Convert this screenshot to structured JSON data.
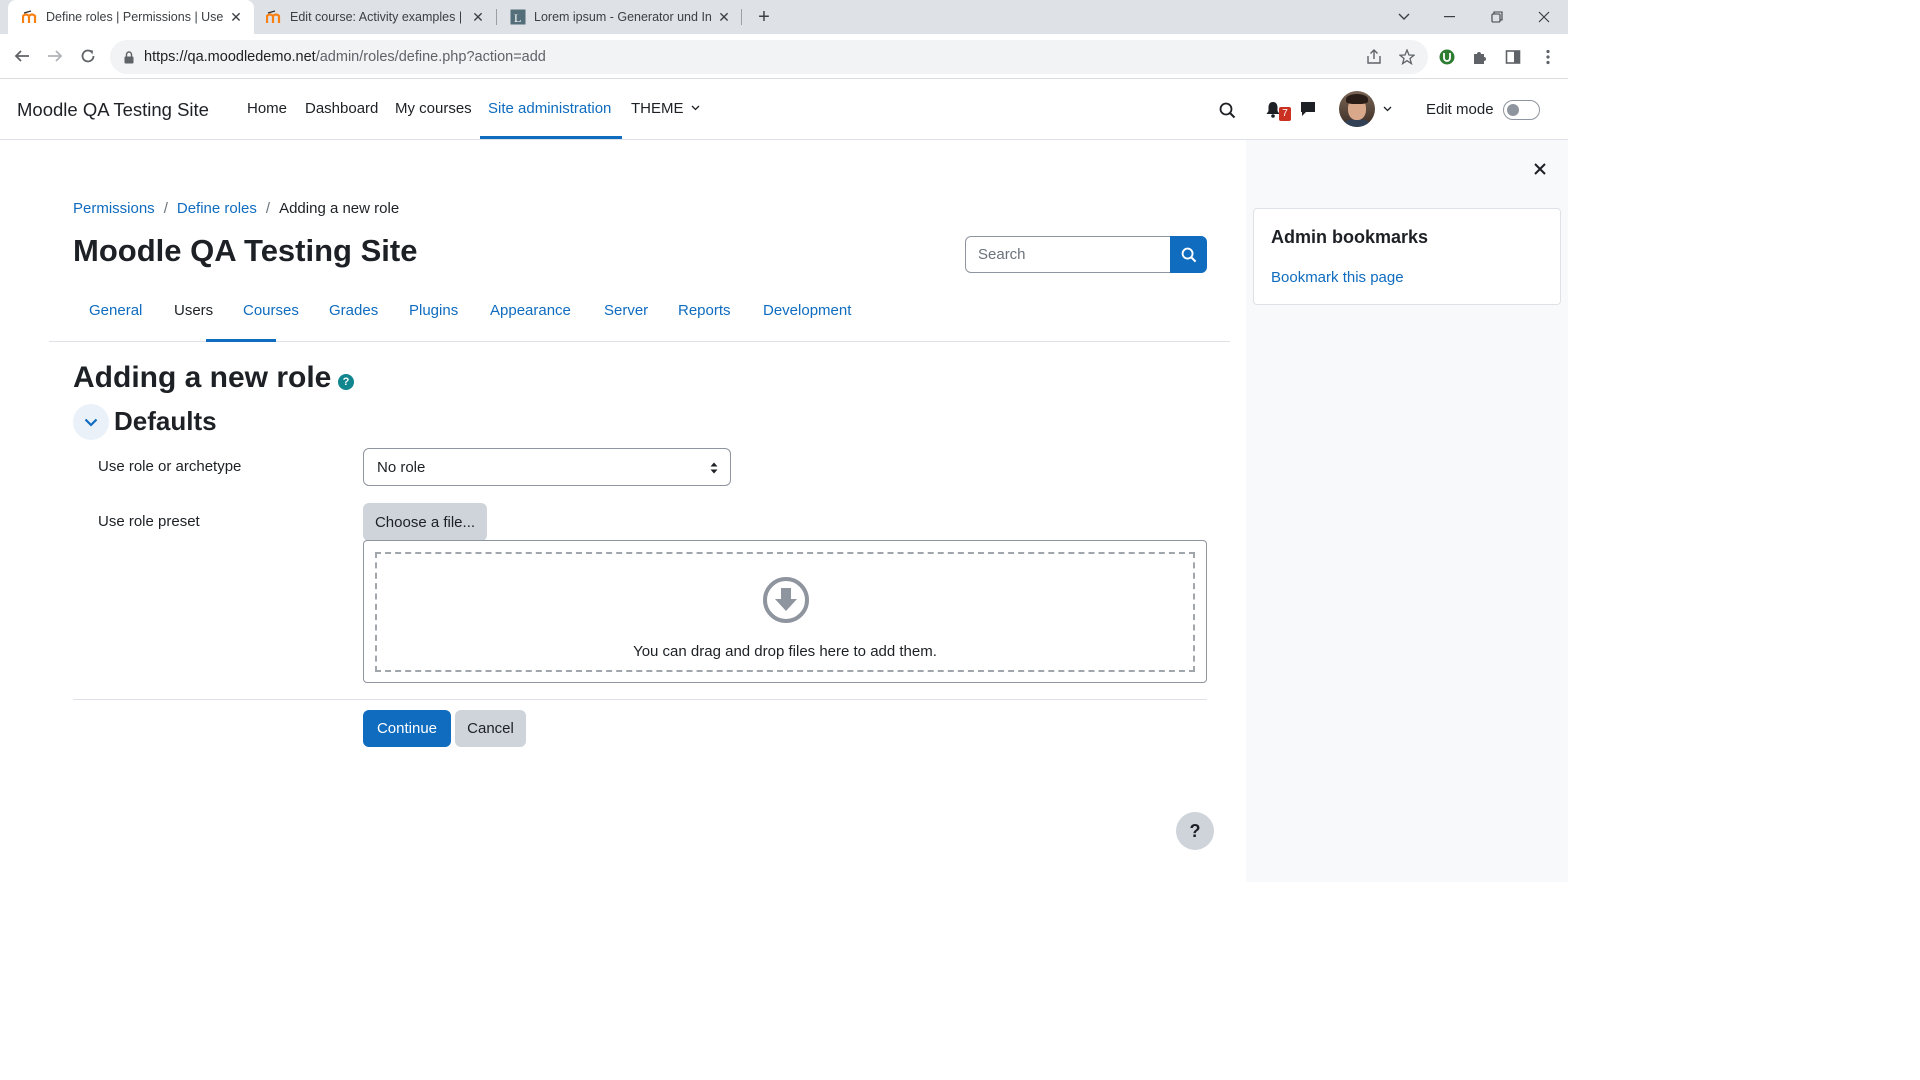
{
  "browser": {
    "tabs": [
      {
        "title": "Define roles | Permissions | Users",
        "favicon": "moodle-icon",
        "active": true
      },
      {
        "title": "Edit course: Activity examples | M",
        "favicon": "moodle-icon",
        "active": false
      },
      {
        "title": "Lorem ipsum - Generator und Inf",
        "favicon": "lorem-icon",
        "active": false
      }
    ],
    "url_host": "https://qa.moodledemo.net",
    "url_path": "/admin/roles/define.php?action=add"
  },
  "navbar": {
    "brand": "Moodle QA Testing Site",
    "items": [
      "Home",
      "Dashboard",
      "My courses",
      "Site administration",
      "THEME"
    ],
    "active_item": "Site administration",
    "notification_count": "7",
    "edit_mode_label": "Edit mode"
  },
  "breadcrumb": {
    "items": [
      "Permissions",
      "Define roles"
    ],
    "current": "Adding a new role"
  },
  "page": {
    "title": "Moodle QA Testing Site",
    "search_placeholder": "Search"
  },
  "subnav": {
    "tabs": [
      "General",
      "Users",
      "Courses",
      "Grades",
      "Plugins",
      "Appearance",
      "Server",
      "Reports",
      "Development"
    ],
    "active": "Users"
  },
  "form": {
    "heading": "Adding a new role",
    "help_glyph": "?",
    "section": "Defaults",
    "archetype_label": "Use role or archetype",
    "archetype_value": "No role",
    "preset_label": "Use role preset",
    "choose_file": "Choose a file...",
    "dropzone_text": "You can drag and drop files here to add them.",
    "continue": "Continue",
    "cancel": "Cancel"
  },
  "drawer": {
    "block_title": "Admin bookmarks",
    "bookmark_link": "Bookmark this page"
  },
  "footer": {
    "help_glyph": "?"
  },
  "colors": {
    "primary": "#0f6cbf",
    "help_teal": "#11868f",
    "badge": "#ca3120"
  }
}
